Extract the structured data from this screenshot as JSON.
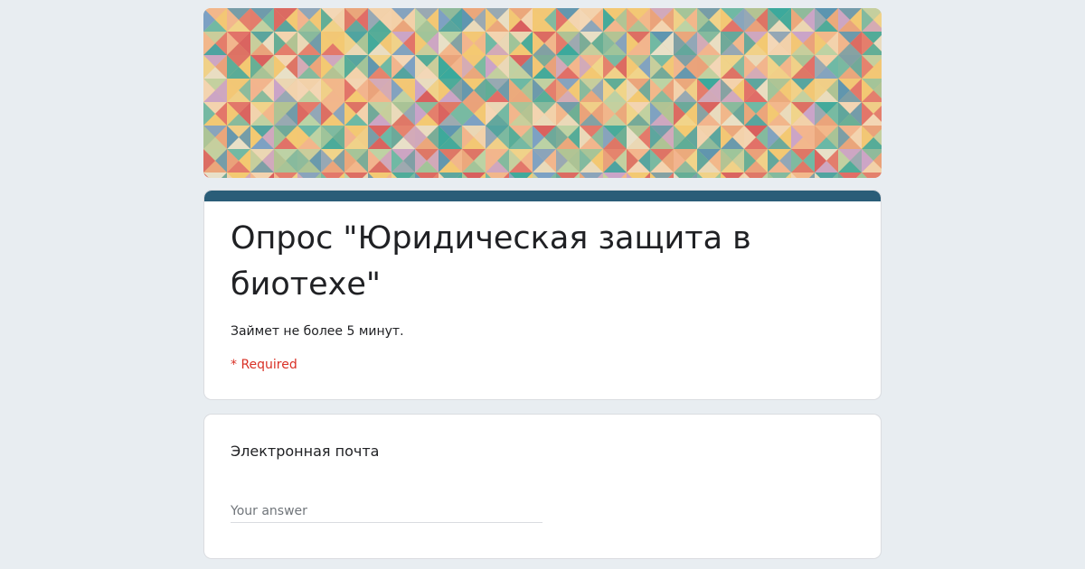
{
  "form": {
    "title": "Опрос \"Юридическая защита в биотехе\"",
    "description": "Займет не более 5 минут.",
    "required_note": "* Required"
  },
  "question": {
    "label": "Электронная почта",
    "answer_placeholder": "Your answer",
    "answer_value": ""
  },
  "colors": {
    "page_background": "#e8edf1",
    "accent": "#2a5d78",
    "required": "#d93025"
  },
  "banner": {
    "pattern": "colorful-triangle-mosaic",
    "palette": [
      "#e9a07a",
      "#f3c971",
      "#67b8a6",
      "#38a89c",
      "#5c95b0",
      "#e06b66",
      "#9dc49a",
      "#f3d7b8",
      "#d85d5d",
      "#7aa0c4",
      "#e8e0c8",
      "#c9a3c9",
      "#f2b48e",
      "#4ea3a0",
      "#f0d48a",
      "#b9d3a6"
    ]
  }
}
